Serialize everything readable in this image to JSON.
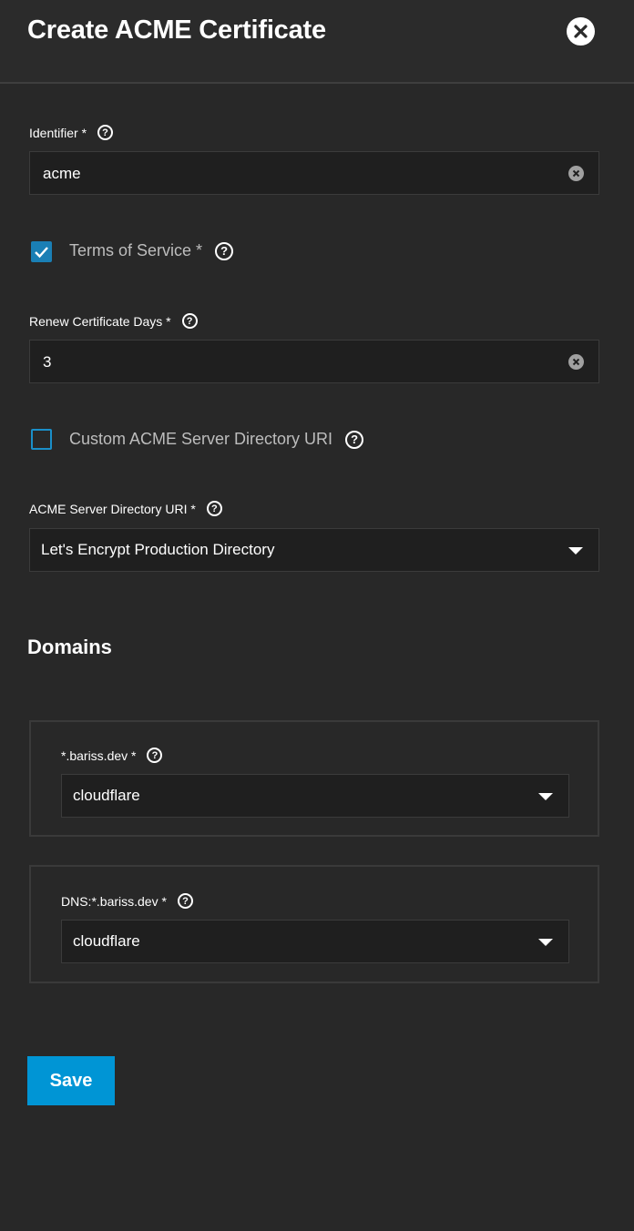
{
  "dialog": {
    "title": "Create ACME Certificate"
  },
  "identifier": {
    "label": "Identifier *",
    "value": "acme"
  },
  "terms": {
    "label": "Terms of Service *",
    "checked": true
  },
  "renew_days": {
    "label": "Renew Certificate Days *",
    "value": "3"
  },
  "custom_uri": {
    "label": "Custom ACME Server Directory URI",
    "checked": false
  },
  "directory_uri": {
    "label": "ACME Server Directory URI *",
    "value": "Let's Encrypt Production Directory"
  },
  "domains": {
    "title": "Domains",
    "items": [
      {
        "label": "*.bariss.dev *",
        "value": "cloudflare"
      },
      {
        "label": "DNS:*.bariss.dev *",
        "value": "cloudflare"
      }
    ]
  },
  "actions": {
    "save_label": "Save"
  },
  "colors": {
    "background": "#282828",
    "accent": "#0095d5",
    "checkbox": "#1a7fb5"
  }
}
